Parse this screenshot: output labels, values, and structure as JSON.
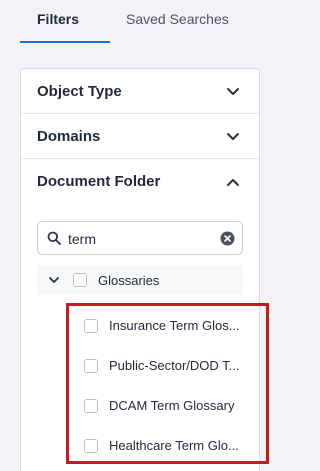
{
  "tabs": [
    {
      "label": "Filters",
      "active": true
    },
    {
      "label": "Saved Searches",
      "active": false
    }
  ],
  "accent_color": "#1d6fd1",
  "highlight_color": "#c21d1d",
  "sections": {
    "object_type": {
      "label": "Object Type",
      "icon": "chevron-down-icon"
    },
    "domains": {
      "label": "Domains",
      "icon": "chevron-down-icon"
    },
    "document_folder": {
      "label": "Document Folder",
      "icon": "chevron-up-icon"
    }
  },
  "search": {
    "value": "term",
    "placeholder": ""
  },
  "tree": {
    "parent": {
      "label": "Glossaries",
      "checked": false,
      "expanded": true
    },
    "children": [
      {
        "label": "Insurance Term Glos...",
        "checked": false
      },
      {
        "label": "Public-Sector/DOD T...",
        "checked": false
      },
      {
        "label": "DCAM Term Glossary",
        "checked": false
      },
      {
        "label": "Healthcare Term Glo...",
        "checked": false
      }
    ]
  }
}
